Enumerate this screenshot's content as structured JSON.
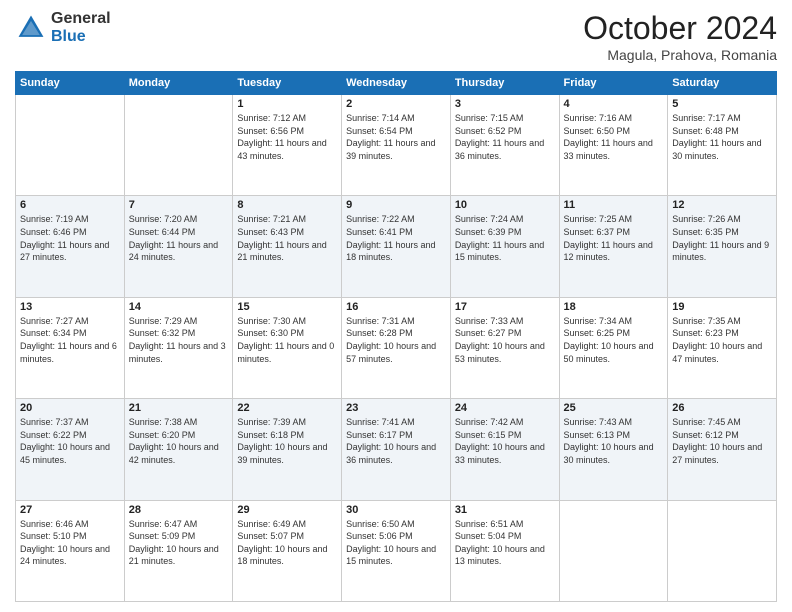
{
  "header": {
    "logo": {
      "line1": "General",
      "line2": "Blue"
    },
    "title": "October 2024",
    "subtitle": "Magula, Prahova, Romania"
  },
  "weekdays": [
    "Sunday",
    "Monday",
    "Tuesday",
    "Wednesday",
    "Thursday",
    "Friday",
    "Saturday"
  ],
  "weeks": [
    [
      {
        "day": "",
        "info": ""
      },
      {
        "day": "",
        "info": ""
      },
      {
        "day": "1",
        "info": "Sunrise: 7:12 AM\nSunset: 6:56 PM\nDaylight: 11 hours and 43 minutes."
      },
      {
        "day": "2",
        "info": "Sunrise: 7:14 AM\nSunset: 6:54 PM\nDaylight: 11 hours and 39 minutes."
      },
      {
        "day": "3",
        "info": "Sunrise: 7:15 AM\nSunset: 6:52 PM\nDaylight: 11 hours and 36 minutes."
      },
      {
        "day": "4",
        "info": "Sunrise: 7:16 AM\nSunset: 6:50 PM\nDaylight: 11 hours and 33 minutes."
      },
      {
        "day": "5",
        "info": "Sunrise: 7:17 AM\nSunset: 6:48 PM\nDaylight: 11 hours and 30 minutes."
      }
    ],
    [
      {
        "day": "6",
        "info": "Sunrise: 7:19 AM\nSunset: 6:46 PM\nDaylight: 11 hours and 27 minutes."
      },
      {
        "day": "7",
        "info": "Sunrise: 7:20 AM\nSunset: 6:44 PM\nDaylight: 11 hours and 24 minutes."
      },
      {
        "day": "8",
        "info": "Sunrise: 7:21 AM\nSunset: 6:43 PM\nDaylight: 11 hours and 21 minutes."
      },
      {
        "day": "9",
        "info": "Sunrise: 7:22 AM\nSunset: 6:41 PM\nDaylight: 11 hours and 18 minutes."
      },
      {
        "day": "10",
        "info": "Sunrise: 7:24 AM\nSunset: 6:39 PM\nDaylight: 11 hours and 15 minutes."
      },
      {
        "day": "11",
        "info": "Sunrise: 7:25 AM\nSunset: 6:37 PM\nDaylight: 11 hours and 12 minutes."
      },
      {
        "day": "12",
        "info": "Sunrise: 7:26 AM\nSunset: 6:35 PM\nDaylight: 11 hours and 9 minutes."
      }
    ],
    [
      {
        "day": "13",
        "info": "Sunrise: 7:27 AM\nSunset: 6:34 PM\nDaylight: 11 hours and 6 minutes."
      },
      {
        "day": "14",
        "info": "Sunrise: 7:29 AM\nSunset: 6:32 PM\nDaylight: 11 hours and 3 minutes."
      },
      {
        "day": "15",
        "info": "Sunrise: 7:30 AM\nSunset: 6:30 PM\nDaylight: 11 hours and 0 minutes."
      },
      {
        "day": "16",
        "info": "Sunrise: 7:31 AM\nSunset: 6:28 PM\nDaylight: 10 hours and 57 minutes."
      },
      {
        "day": "17",
        "info": "Sunrise: 7:33 AM\nSunset: 6:27 PM\nDaylight: 10 hours and 53 minutes."
      },
      {
        "day": "18",
        "info": "Sunrise: 7:34 AM\nSunset: 6:25 PM\nDaylight: 10 hours and 50 minutes."
      },
      {
        "day": "19",
        "info": "Sunrise: 7:35 AM\nSunset: 6:23 PM\nDaylight: 10 hours and 47 minutes."
      }
    ],
    [
      {
        "day": "20",
        "info": "Sunrise: 7:37 AM\nSunset: 6:22 PM\nDaylight: 10 hours and 45 minutes."
      },
      {
        "day": "21",
        "info": "Sunrise: 7:38 AM\nSunset: 6:20 PM\nDaylight: 10 hours and 42 minutes."
      },
      {
        "day": "22",
        "info": "Sunrise: 7:39 AM\nSunset: 6:18 PM\nDaylight: 10 hours and 39 minutes."
      },
      {
        "day": "23",
        "info": "Sunrise: 7:41 AM\nSunset: 6:17 PM\nDaylight: 10 hours and 36 minutes."
      },
      {
        "day": "24",
        "info": "Sunrise: 7:42 AM\nSunset: 6:15 PM\nDaylight: 10 hours and 33 minutes."
      },
      {
        "day": "25",
        "info": "Sunrise: 7:43 AM\nSunset: 6:13 PM\nDaylight: 10 hours and 30 minutes."
      },
      {
        "day": "26",
        "info": "Sunrise: 7:45 AM\nSunset: 6:12 PM\nDaylight: 10 hours and 27 minutes."
      }
    ],
    [
      {
        "day": "27",
        "info": "Sunrise: 6:46 AM\nSunset: 5:10 PM\nDaylight: 10 hours and 24 minutes."
      },
      {
        "day": "28",
        "info": "Sunrise: 6:47 AM\nSunset: 5:09 PM\nDaylight: 10 hours and 21 minutes."
      },
      {
        "day": "29",
        "info": "Sunrise: 6:49 AM\nSunset: 5:07 PM\nDaylight: 10 hours and 18 minutes."
      },
      {
        "day": "30",
        "info": "Sunrise: 6:50 AM\nSunset: 5:06 PM\nDaylight: 10 hours and 15 minutes."
      },
      {
        "day": "31",
        "info": "Sunrise: 6:51 AM\nSunset: 5:04 PM\nDaylight: 10 hours and 13 minutes."
      },
      {
        "day": "",
        "info": ""
      },
      {
        "day": "",
        "info": ""
      }
    ]
  ]
}
